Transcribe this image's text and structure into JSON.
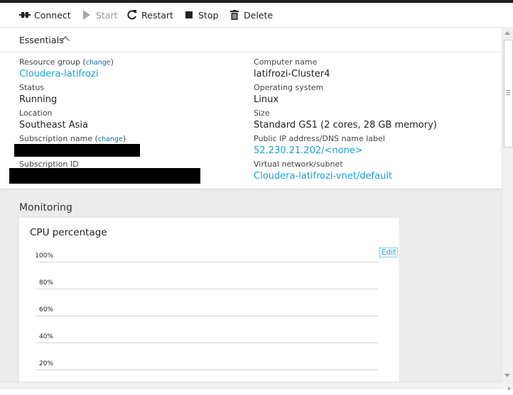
{
  "toolbar": {
    "connect": "Connect",
    "start": "Start",
    "restart": "Restart",
    "stop": "Stop",
    "delete": "Delete"
  },
  "essentials": {
    "title": "Essentials",
    "resource_group_label": "Resource group",
    "change": "change",
    "resource_group_value": "Cloudera-latifrozi",
    "status_label": "Status",
    "status_value": "Running",
    "location_label": "Location",
    "location_value": "Southeast Asia",
    "subscription_name_label": "Subscription name",
    "subscription_id_label": "Subscription ID",
    "computer_name_label": "Computer name",
    "computer_name_value": "latifrozi-Cluster4",
    "os_label": "Operating system",
    "os_value": "Linux",
    "size_label": "Size",
    "size_value": "Standard GS1 (2 cores, 28 GB memory)",
    "public_ip_label": "Public IP address/DNS name label",
    "public_ip_value": "52.230.21.202/<none>",
    "vnet_label": "Virtual network/subnet",
    "vnet_value": "Cloudera-latifrozi-vnet/default"
  },
  "monitoring": {
    "title": "Monitoring",
    "chart_title": "CPU percentage",
    "edit": "Edit"
  },
  "chart_data": {
    "type": "line",
    "title": "CPU percentage",
    "ytick_labels": [
      "100%",
      "80%",
      "60%",
      "40%",
      "20%"
    ],
    "series": []
  },
  "colors": {
    "link": "#1a9fd9",
    "topbar": "#1e1e1e",
    "monitoring_bg": "#ececec"
  }
}
